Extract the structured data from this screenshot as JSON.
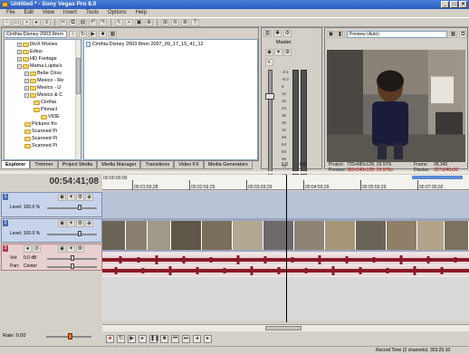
{
  "window": {
    "title": "Untitled * - Sony Vegas Pro 8.0",
    "buttons": [
      "_",
      "□",
      "×"
    ]
  },
  "menu": [
    "File",
    "Edit",
    "View",
    "Insert",
    "Tools",
    "Options",
    "Help"
  ],
  "explorer": {
    "path": "Cinthia Disney 2003 8mm",
    "tree": [
      "DivX Movies",
      "Edius",
      "HD Footage",
      "Mama Lupita's",
      "Bebe Criss",
      "Mexico - Re",
      "Mexico - U",
      "Mexico & C",
      "Cinthia",
      "Pinnacl",
      "VIDE",
      "Pictures fro",
      "Scanned Pi",
      "Scanned Pi",
      "Scanned Pi"
    ],
    "file": "Cinthia Disney 2003 8mm 2007_09_17_15_41_12"
  },
  "tabs": [
    "Explorer",
    "Trimmer",
    "Project Media",
    "Media Manager",
    "Transitions",
    "Video FX",
    "Media Generators"
  ],
  "mixer": {
    "label": "Master",
    "scale": [
      "-3.1",
      "-6.0",
      "6",
      "12",
      "18",
      "24",
      "30",
      "36",
      "42",
      "48",
      "54",
      "60",
      "66",
      "72",
      "78",
      "84"
    ],
    "bottom": [
      "0.0",
      "0.0"
    ]
  },
  "preview": {
    "mode": "Preview (Auto)",
    "project_label": "Project:",
    "project_value": "720x480x128, 29.970i",
    "preview_label": "Preview:",
    "preview_value": "360x240x128, 29.970p",
    "frame_label": "Frame:",
    "frame_value": "98,340",
    "display_label": "Display:",
    "display_value": "327x240x32"
  },
  "timeline": {
    "timecode": "00:54:41;08",
    "ruler": [
      "00:01:59;28",
      "00:02:59;29",
      "00:03:59;29",
      "00:04:59;29",
      "00:05:59;29",
      "00:07:00;02"
    ],
    "ruler_start": "00:00:00;00"
  },
  "tracks": [
    {
      "num": "1",
      "level": "Level: 100.0 %"
    },
    {
      "num": "2",
      "level": "Level: 100.0 %"
    },
    {
      "num": "3",
      "vol_label": "Vol:",
      "vol": "0.0 dB",
      "pan_label": "Pan:",
      "pan": "Center"
    }
  ],
  "rate": "Rate: 0.00",
  "status": "Record Time (2 channels): 303:25:10",
  "colors": {
    "title": "#2b5bbf",
    "video_track": "#c8d4ec",
    "audio_wave": "#8a1a28"
  }
}
